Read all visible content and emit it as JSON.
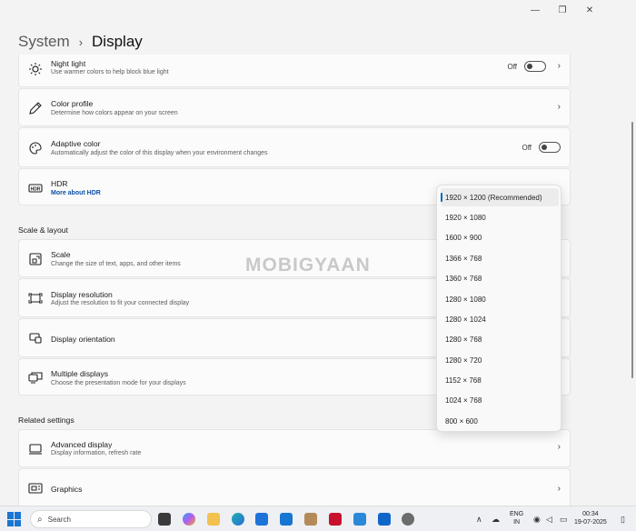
{
  "window": {
    "minimize_glyph": "—",
    "maximize_glyph": "❐",
    "close_glyph": "✕"
  },
  "breadcrumb": {
    "parent": "System",
    "separator": "›",
    "current": "Display"
  },
  "cards": {
    "night_light": {
      "title": "Night light",
      "desc": "Use warmer colors to help block blue light",
      "state": "Off"
    },
    "color_profile": {
      "title": "Color profile",
      "desc": "Determine how colors appear on your screen"
    },
    "adaptive_color": {
      "title": "Adaptive color",
      "desc": "Automatically adjust the color of this display when your environment changes",
      "state": "Off"
    },
    "hdr": {
      "title": "HDR",
      "link": "More about HDR"
    },
    "scale": {
      "title": "Scale",
      "desc": "Change the size of text, apps, and other items"
    },
    "display_resolution": {
      "title": "Display resolution",
      "desc": "Adjust the resolution to fit your connected display"
    },
    "display_orientation": {
      "title": "Display orientation"
    },
    "multiple_displays": {
      "title": "Multiple displays",
      "desc": "Choose the presentation mode for your displays"
    },
    "advanced_display": {
      "title": "Advanced display",
      "desc": "Display information, refresh rate"
    },
    "graphics": {
      "title": "Graphics"
    }
  },
  "sections": {
    "scale_layout": "Scale & layout",
    "related": "Related settings"
  },
  "chevron": "›",
  "resolution_dropdown": {
    "selected_index": 0,
    "options": [
      "1920 × 1200 (Recommended)",
      "1920 × 1080",
      "1600 × 900",
      "1366 × 768",
      "1360 × 768",
      "1280 × 1080",
      "1280 × 1024",
      "1280 × 768",
      "1280 × 720",
      "1152 × 768",
      "1024 × 768",
      "800 × 600"
    ]
  },
  "watermark": "MOBIGYAAN",
  "taskbar": {
    "search_label": "Search",
    "language": "ENG",
    "region": "IN",
    "time": "00:34",
    "date": "19-07-2025",
    "tray_up_glyph": "∧"
  },
  "icons": {
    "night_light": "brightness-icon",
    "color_profile": "pen-icon",
    "adaptive_color": "palette-icon",
    "hdr": "hdr-icon",
    "scale": "scale-icon",
    "display_resolution": "resolution-icon",
    "display_orientation": "orientation-icon",
    "multiple_displays": "multiple-displays-icon",
    "advanced_display": "monitor-icon",
    "graphics": "graphics-icon"
  },
  "colors": {
    "accent": "#0067c0",
    "link": "#0a4fa8",
    "background": "#f3f3f3",
    "card": "#fbfbfb"
  }
}
